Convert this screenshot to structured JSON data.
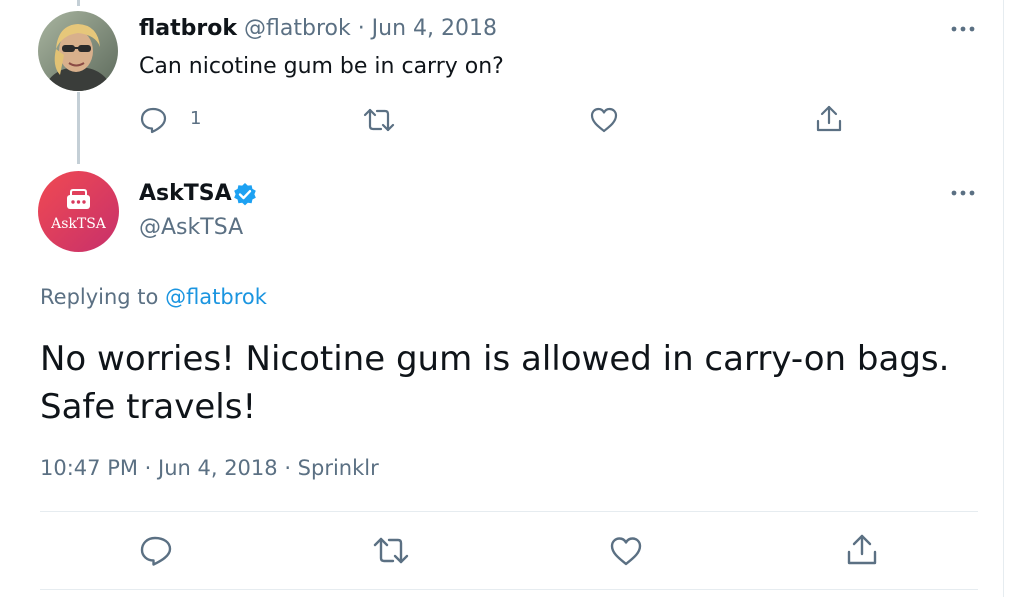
{
  "parent_tweet": {
    "display_name": "flatbrok",
    "meta": "@flatbrok · Jun 4, 2018",
    "text": "Can nicotine gum be in carry on?",
    "reply_count": "1"
  },
  "reply_tweet": {
    "display_name": "AskTSA",
    "handle": "@AskTSA",
    "avatar_text": "AskTSA",
    "replying_prefix": "Replying to ",
    "replying_to": "@flatbrok",
    "text_line1": "No worries! Nicotine gum is allowed in carry-on bags.",
    "text_line2": "Safe travels!",
    "timestamp": "10:47 PM · Jun 4, 2018 · Sprinklr"
  },
  "icons": {
    "more": "more-horizontal-icon",
    "reply": "reply-icon",
    "retweet": "retweet-icon",
    "like": "heart-icon",
    "share": "share-icon",
    "verified": "verified-badge-icon"
  },
  "colors": {
    "text": "#0f1419",
    "muted": "#5b7083",
    "link": "#1b95e0",
    "verified": "#1da1f2",
    "divider": "#e6ecf0",
    "thread_line": "#c4cfd6",
    "avatar_gradient_start": "#f04a52",
    "avatar_gradient_end": "#c7306b"
  }
}
